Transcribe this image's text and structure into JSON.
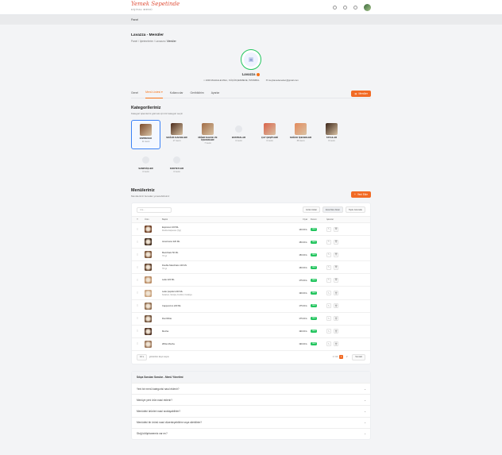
{
  "app": {
    "logo": "Yemek Sepetinde",
    "logo_sub": "DİJİTAL MENÜ"
  },
  "breadcrumb": {
    "root": "Panel"
  },
  "page": {
    "title": "Lavazza - Menüler",
    "crumb_path": "Panel / İşletmelerim / Lavazza / ",
    "crumb_current": "Menüler"
  },
  "business": {
    "name": "Lavazza",
    "address": "1000 MAHALLE MAH., KÜÇÜKÇEKMECE, İSTANBUL",
    "email": "meyhanedeneden@gmail.com"
  },
  "tabs": [
    "Genel",
    "Menü Listesi",
    "Kullanıcılar",
    "Geribildirim",
    "Ayarlar"
  ],
  "tabs_active": 1,
  "tabs_button": "Menüler",
  "categories": {
    "title": "Kategorileriniz",
    "subtitle": "Kategori işlemlerini görmek için bir kategori seçin",
    "items": [
      {
        "name": "ESPRESSO",
        "count": "11 menü",
        "color": "#7a4a2a"
      },
      {
        "name": "SOĞUK KAHVELER",
        "count": "17 menü",
        "color": "#4a2a1a"
      },
      {
        "name": "DİĞER KAHVE VE İÇECEKLER",
        "count": "7 menü",
        "color": "#a06b45"
      },
      {
        "name": "EKSTRALAR",
        "count": "0 menü",
        "color": ""
      },
      {
        "name": "ÇAY ÇEŞİTLERİ",
        "count": "0 menü",
        "color": "#d9624a"
      },
      {
        "name": "SOĞUK İÇECEKLER",
        "count": "38 menü",
        "color": "#e38a5c"
      },
      {
        "name": "TATLILAR",
        "count": "8 menü",
        "color": "#3a2418"
      },
      {
        "name": "SANDVİÇLER",
        "count": "0 menü",
        "color": ""
      },
      {
        "name": "KOKTEYLER",
        "count": "0 menü",
        "color": ""
      }
    ]
  },
  "menus": {
    "title": "Menüleriniz",
    "subtitle": "Menülerinizi buradan yönetebilirsiniz",
    "add_button": "Yeni Ekle",
    "search_placeholder": "Ara...",
    "toolbar": [
      "Gizleri Aktar",
      "Excel'den Aktar",
      "Toplu Güncelle"
    ],
    "columns": [
      "",
      "Ürün",
      "Başlık",
      "Fiyat",
      "Durum",
      "İşlemler"
    ],
    "rows": [
      {
        "name": "Espresso 100 ML",
        "desc": "Double Espresso (7gr)",
        "price": "140.00 ₺",
        "status": "Aktif",
        "color": "#6b3a1e"
      },
      {
        "name": "Americano 220 ML",
        "desc": "",
        "price": "150.00 ₺",
        "status": "Aktif",
        "color": "#3b2414"
      },
      {
        "name": "Macchiato 50 ML",
        "desc": "7/4 gr",
        "price": "150.00 ₺",
        "status": "Aktif",
        "color": "#7b5336"
      },
      {
        "name": "Double Macchiato 100 ML",
        "desc": "7/4 gr",
        "price": "160.00 ₺",
        "status": "Aktif",
        "color": "#5a3a24"
      },
      {
        "name": "Latte 220 ML",
        "desc": "",
        "price": "175.00 ₺",
        "status": "Aktif",
        "color": "#b98a62"
      },
      {
        "name": "Latte Çeşitleri 220 ML",
        "desc": "Karamel, Vanilya, Fındıklı, Kurabiye",
        "price": "190.00 ₺",
        "status": "Aktif",
        "color": "#c9a27d"
      },
      {
        "name": "Cappuccino 220 ML",
        "desc": "",
        "price": "175.00 ₺",
        "status": "Aktif",
        "color": "#8d6a4c"
      },
      {
        "name": "Flat White",
        "desc": "",
        "price": "175.00 ₺",
        "status": "Aktif",
        "color": "#6e4e36"
      },
      {
        "name": "Mocha",
        "desc": "",
        "price": "190.00 ₺",
        "status": "Aktif",
        "color": "#4a2c1c"
      },
      {
        "name": "White Mocha",
        "desc": "",
        "price": "190.00 ₺",
        "status": "Aktif",
        "color": "#9a7456"
      }
    ],
    "per_page": "10",
    "per_page_label": "gösterilen kayıt sayısı",
    "range": "1 / 10",
    "pages": [
      "1",
      "2"
    ],
    "next": "Sonraki"
  },
  "faq": {
    "title": "Sıkça Sorulan Sorular - Menü Yönetimi",
    "items": [
      "Yeni bir menü kategorisi nasıl eklenir?",
      "Menüye yeni ürün nasıl eklenir?",
      "Menüdeki ürünleri nasıl sıralayabilirim?",
      "Menüdeki bir ürünü nasıl düzenleyebilirim veya silebilirim?",
      "Stoğ kötüphanemiz var mı?"
    ]
  }
}
